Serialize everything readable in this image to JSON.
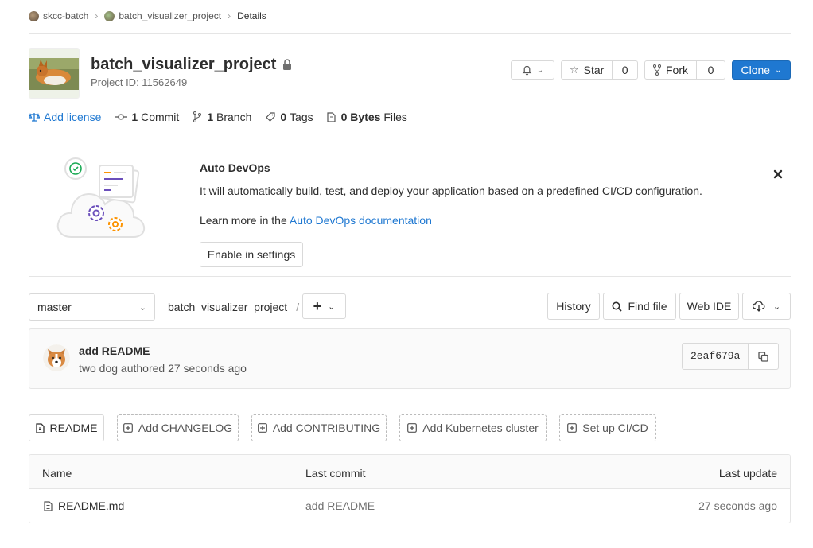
{
  "breadcrumb": {
    "group": "skcc-batch",
    "project": "batch_visualizer_project",
    "current": "Details"
  },
  "project": {
    "name": "batch_visualizer_project",
    "id_label": "Project ID: 11562649"
  },
  "actions": {
    "star_label": "Star",
    "star_count": "0",
    "fork_label": "Fork",
    "fork_count": "0",
    "clone_label": "Clone"
  },
  "stats": {
    "add_license": "Add license",
    "commits_num": "1",
    "commits_label": "Commit",
    "branches_num": "1",
    "branches_label": "Branch",
    "tags_num": "0",
    "tags_label": "Tags",
    "files_num": "0 Bytes",
    "files_label": "Files"
  },
  "devops": {
    "title": "Auto DevOps",
    "description": "It will automatically build, test, and deploy your application based on a predefined CI/CD configuration.",
    "learn_prefix": "Learn more in the",
    "learn_link": "Auto DevOps documentation",
    "enable_button": "Enable in settings"
  },
  "repo": {
    "branch": "master",
    "path": "batch_visualizer_project",
    "separator": "/",
    "history": "History",
    "find_file": "Find file",
    "web_ide": "Web IDE"
  },
  "commit": {
    "message": "add README",
    "author_line": "two dog authored 27 seconds ago",
    "sha": "2eaf679a"
  },
  "quick_links": {
    "readme": "README",
    "changelog": "Add CHANGELOG",
    "contributing": "Add CONTRIBUTING",
    "kubernetes": "Add Kubernetes cluster",
    "cicd": "Set up CI/CD"
  },
  "file_table": {
    "headers": {
      "name": "Name",
      "last_commit": "Last commit",
      "last_update": "Last update"
    },
    "rows": [
      {
        "name": "README.md",
        "last_commit": "add README",
        "last_update": "27 seconds ago"
      }
    ]
  },
  "colors": {
    "link": "#1f78d1",
    "clone_button": "#1f78d1",
    "border": "#e5e5e5"
  }
}
